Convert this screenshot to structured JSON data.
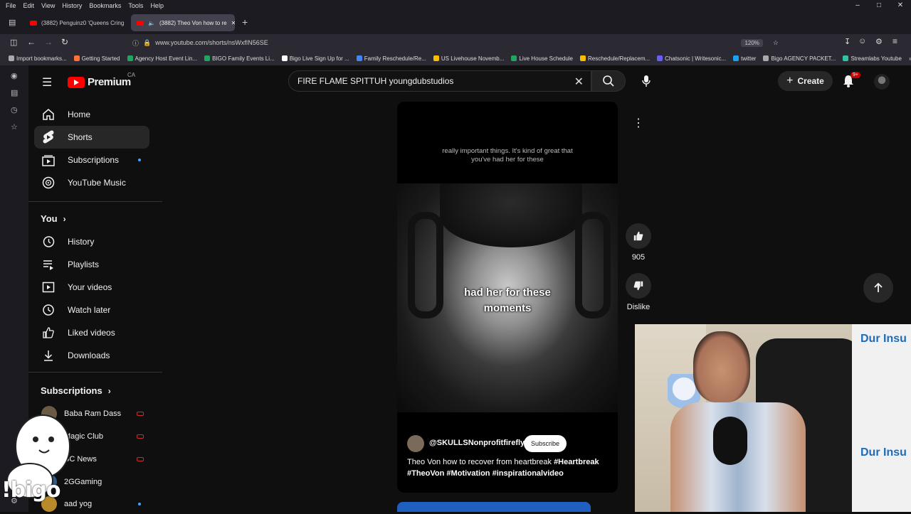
{
  "browser": {
    "menu": [
      "File",
      "Edit",
      "View",
      "History",
      "Bookmarks",
      "Tools",
      "Help"
    ],
    "tabs": [
      {
        "title": "(3882) Penguinz0 'Queens Cring"
      },
      {
        "title": "(3882) Theo Von how to re"
      }
    ],
    "url": "www.youtube.com/shorts/nsWxfIN56SE",
    "zoom": "120%",
    "bookmarks": [
      {
        "label": "Import bookmarks...",
        "color": "#aaaaaa"
      },
      {
        "label": "Getting Started",
        "color": "#ff7139"
      },
      {
        "label": "Agency Host Event Lin...",
        "color": "#1fa463"
      },
      {
        "label": "BIGO Family Events Li...",
        "color": "#1fa463"
      },
      {
        "label": "Bigo Live Sign Up for ...",
        "color": "#ffffff"
      },
      {
        "label": "Family Reschedule/Re...",
        "color": "#4285f4"
      },
      {
        "label": "US Livehouse Novemb...",
        "color": "#fbbc04"
      },
      {
        "label": "Live House Schedule",
        "color": "#1fa463"
      },
      {
        "label": "Reschedule/Replacem...",
        "color": "#fbbc04"
      },
      {
        "label": "Chatsonic | Writesonic...",
        "color": "#6b5cff"
      },
      {
        "label": "twitter",
        "color": "#1da1f2"
      },
      {
        "label": "Bigo AGENCY PACKET...",
        "color": "#aaaaaa"
      },
      {
        "label": "Streamlabs Youtube",
        "color": "#31c3a2"
      }
    ]
  },
  "youtube": {
    "brand": "Premium",
    "country": "CA",
    "search": {
      "value": "FIRE FLAME SPITTUH youngdubstudios"
    },
    "create_label": "Create",
    "notif_badge": "9+",
    "nav": [
      {
        "label": "Home",
        "icon": "home-icon"
      },
      {
        "label": "Shorts",
        "icon": "shorts-icon"
      },
      {
        "label": "Subscriptions",
        "icon": "subscriptions-icon"
      },
      {
        "label": "YouTube Music",
        "icon": "music-icon"
      }
    ],
    "you_section": "You",
    "you_items": [
      {
        "label": "History",
        "icon": "history-icon"
      },
      {
        "label": "Playlists",
        "icon": "playlists-icon"
      },
      {
        "label": "Your videos",
        "icon": "your-videos-icon"
      },
      {
        "label": "Watch later",
        "icon": "watch-later-icon"
      },
      {
        "label": "Liked videos",
        "icon": "liked-icon"
      },
      {
        "label": "Downloads",
        "icon": "download-icon"
      }
    ],
    "subs_section": "Subscriptions",
    "subscriptions": [
      {
        "label": "Baba Ram Dass",
        "live": true
      },
      {
        "label": "Magic Club",
        "live": true
      },
      {
        "label": "BC News",
        "live": true
      },
      {
        "label": "2GGaming",
        "live": false
      },
      {
        "label": "aad yog",
        "live": false
      }
    ],
    "short": {
      "caption_top": "really important things. It's kind of great that you've had her for these",
      "caption_mid": "had her for these moments",
      "channel": "@SKULLSNonprofitfirefly",
      "subscribe_label": "Subscribe",
      "title_plain": "Theo Von how to recover from heartbreak ",
      "title_tags_1": "#Heartbreak",
      "title_tags_2": "#TheoVon #Motivation #inspirationalvideo",
      "likes": "905",
      "dislike_label": "Dislike"
    }
  },
  "overlay": {
    "watermark": "!bigo",
    "poster_text": "Dur Insu"
  }
}
